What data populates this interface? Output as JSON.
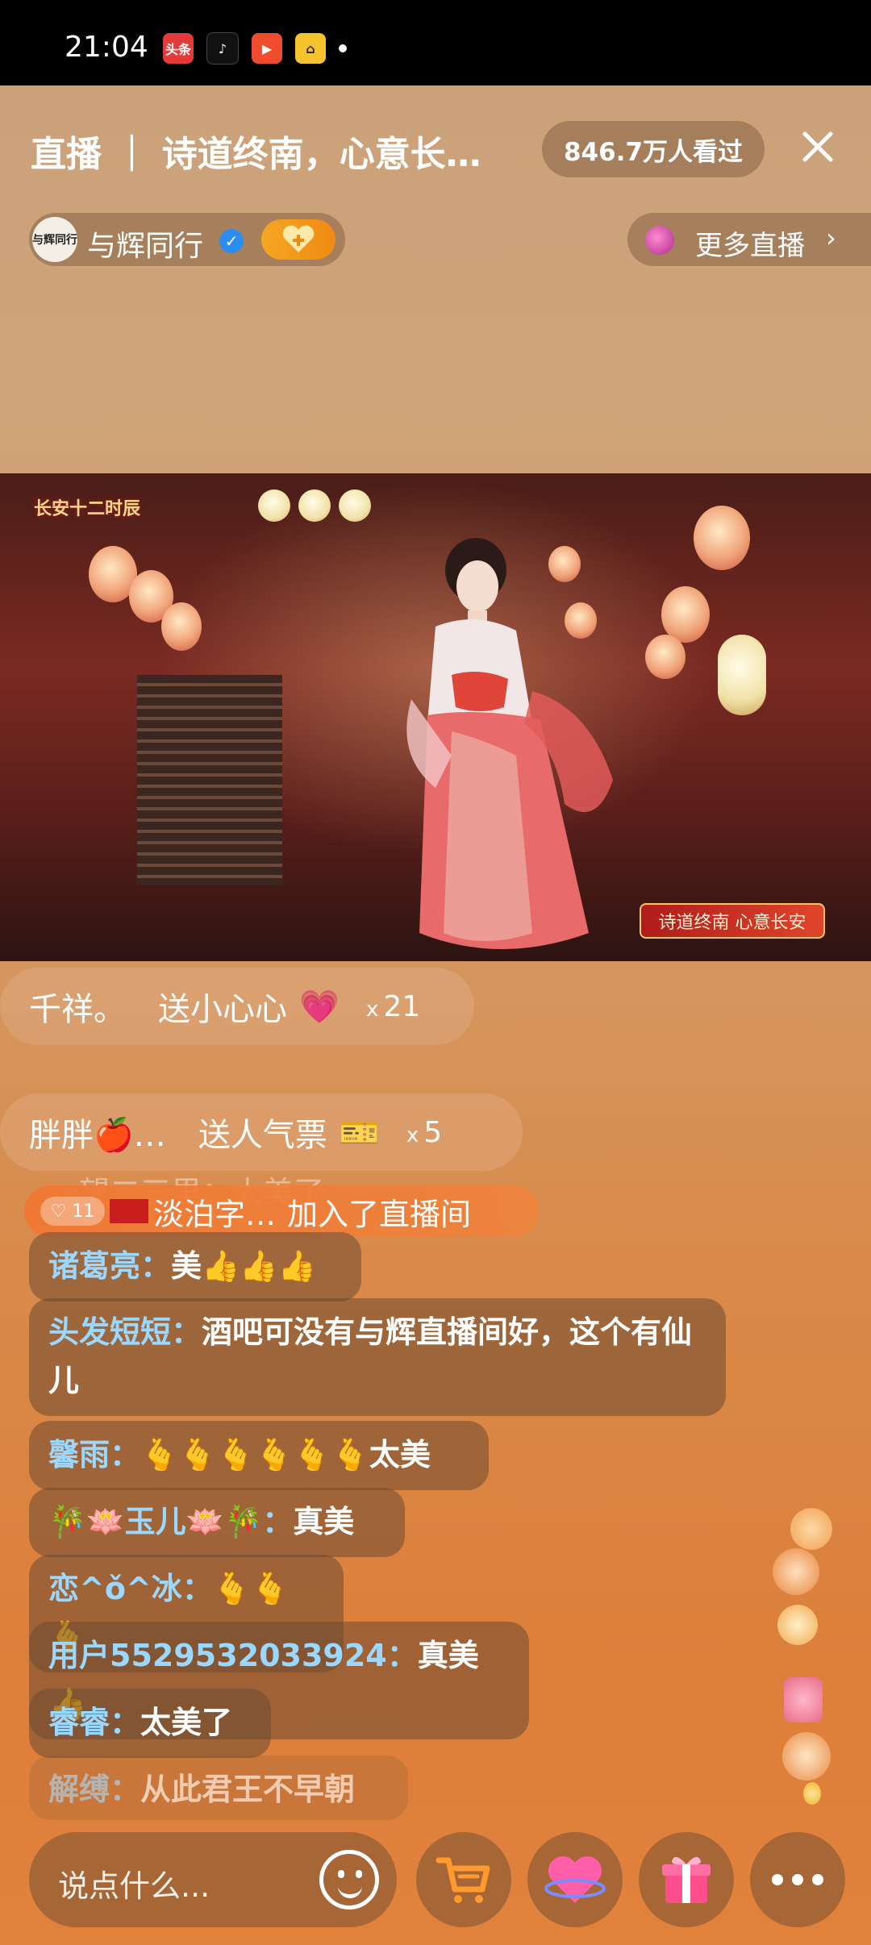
{
  "status_bar": {
    "time": "21:04",
    "app_icons": [
      {
        "name": "toutiao-icon",
        "label": "头条",
        "color": "#e43a3a"
      },
      {
        "name": "tiktok-icon",
        "label": "♪",
        "color": "#111111"
      },
      {
        "name": "video-play-icon",
        "label": "▶",
        "color": "#ef4b2d"
      },
      {
        "name": "car-app-icon",
        "label": "⌂",
        "color": "#f6c22e"
      }
    ]
  },
  "header": {
    "title": "直播 ｜ 诗道终南，心意长…",
    "viewers": "846.7万人看过",
    "host_name": "与辉同行",
    "host_avatar_text": "与辉同行",
    "more_live": "更多直播"
  },
  "video": {
    "logo_text": "长安十二时辰",
    "badge_text": "诗道终南 心意长安"
  },
  "gifts": [
    {
      "user": "千祥。",
      "text": "送小心心",
      "icon": "💗",
      "x_label": "x",
      "count": "21"
    },
    {
      "user": "胖胖🍎…",
      "text": "送人气票",
      "icon": "🎫",
      "x_label": "x",
      "count": "5"
    }
  ],
  "join": {
    "ghost": "一望二三里：太美了",
    "level": "♡ 11",
    "user": "淡泊字…",
    "text": "加入了直播间"
  },
  "comments": [
    {
      "name": "诸葛亮：",
      "text": "美👍👍👍"
    },
    {
      "name": "头发短短：",
      "text": "酒吧可没有与辉直播间好，这个有仙儿"
    },
    {
      "name": "馨雨：",
      "text": "🫰🫰🫰🫰🫰🫰太美"
    },
    {
      "name": "🎋🪷玉儿🪷🎋：",
      "text": "真美"
    },
    {
      "name": "恋^ǒ^冰：",
      "text": "🫰🫰🫰"
    },
    {
      "name": "用户5529532033924：",
      "text": "真美👍"
    },
    {
      "name": "睿睿：",
      "text": "太美了"
    },
    {
      "name": "解缚：",
      "text": "从此君王不早朝"
    }
  ],
  "bottom_bar": {
    "input_placeholder": "说点什么..."
  }
}
